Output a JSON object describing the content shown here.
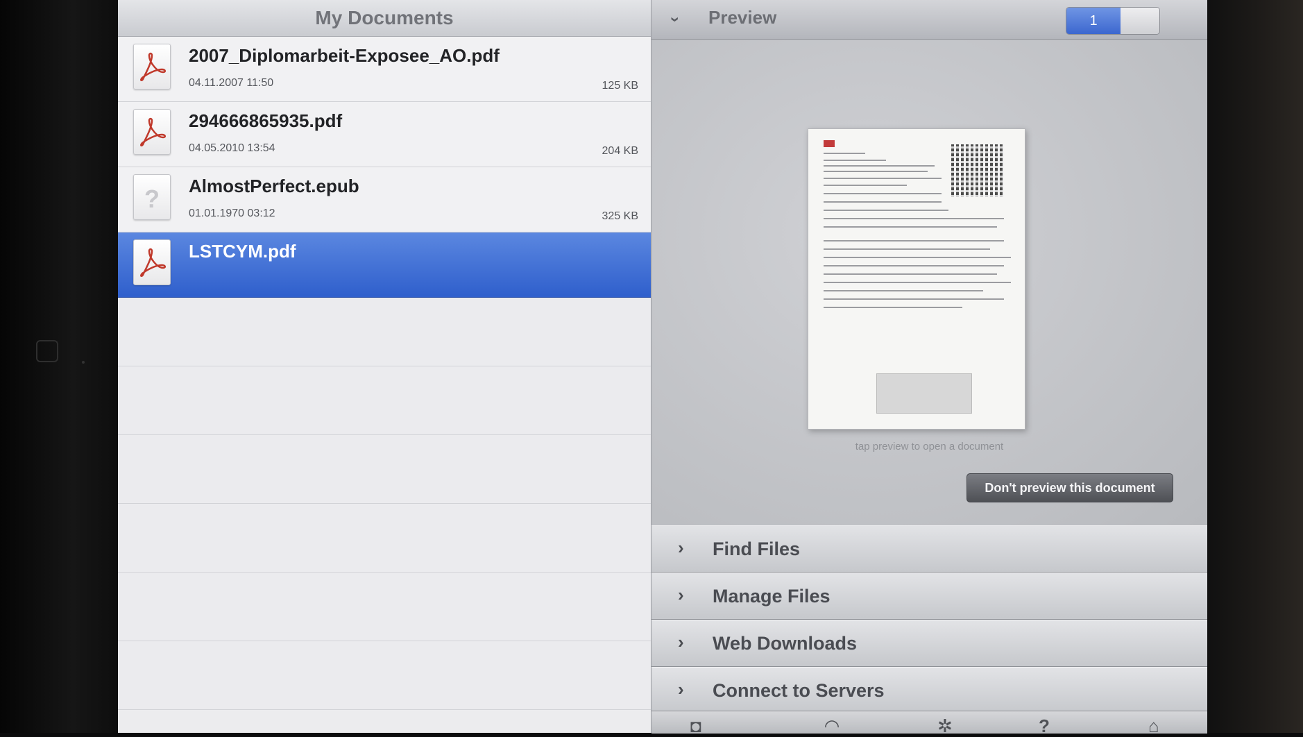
{
  "left_panel": {
    "title": "My Documents",
    "files": [
      {
        "name": "2007_Diplomarbeit-Exposee_AO.pdf",
        "date": "04.11.2007 11:50",
        "size": "125 KB",
        "icon": "pdf-icon"
      },
      {
        "name": "294666865935.pdf",
        "date": "04.05.2010 13:54",
        "size": "204 KB",
        "icon": "pdf-icon"
      },
      {
        "name": "AlmostPerfect.epub",
        "date": "01.01.1970 03:12",
        "size": "325 KB",
        "icon": "unknown-file-icon"
      },
      {
        "name": "LSTCYM.pdf",
        "date": "",
        "size": "",
        "icon": "pdf-icon",
        "selected": true
      }
    ]
  },
  "preview": {
    "title": "Preview",
    "page_indicator": "1",
    "tap_hint": "tap preview to open a document",
    "dont_preview_label": "Don't preview this document"
  },
  "menu": {
    "items": [
      {
        "label": "Find Files"
      },
      {
        "label": "Manage Files"
      },
      {
        "label": "Web Downloads"
      },
      {
        "label": "Connect to Servers"
      }
    ]
  },
  "colors": {
    "selection": "#3a67d0",
    "pdf_red": "#c0392b"
  }
}
